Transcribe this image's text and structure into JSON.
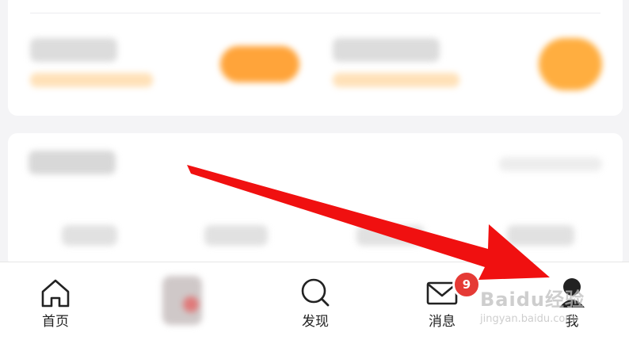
{
  "colors": {
    "accent_orange": "#ff9d2e",
    "badge_red": "#e53a35",
    "arrow_red": "#f01010"
  },
  "tabbar": {
    "tabs": [
      {
        "label": "首页",
        "icon": "home-icon"
      },
      {
        "label": "",
        "icon": "avatar-center"
      },
      {
        "label": "发现",
        "icon": "search-icon"
      },
      {
        "label": "消息",
        "icon": "mail-icon"
      },
      {
        "label": "我",
        "icon": "user-icon"
      }
    ],
    "message_badge": "9"
  },
  "watermark": {
    "line1": "Baidu经验",
    "line2": "jingyan.baidu.com"
  }
}
